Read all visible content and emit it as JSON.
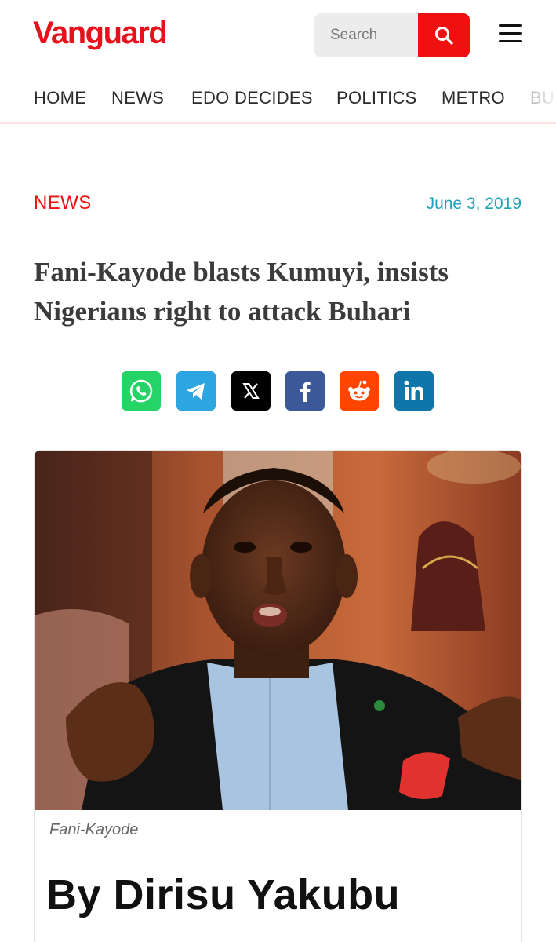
{
  "header": {
    "logo": "Vanguard",
    "search_placeholder": "Search"
  },
  "nav": {
    "items": [
      "HOME",
      "NEWS",
      "EDO DECIDES",
      "POLITICS",
      "METRO",
      "BU"
    ]
  },
  "article": {
    "category": "NEWS",
    "date": "June 3, 2019",
    "title": "Fani-Kayode blasts Kumuyi, insists Nigerians right to attack Buhari",
    "caption": "Fani-Kayode",
    "byline": "By Dirisu Yakubu"
  },
  "share": {
    "icons": [
      "whatsapp-icon",
      "telegram-icon",
      "x-icon",
      "facebook-icon",
      "reddit-icon",
      "linkedin-icon"
    ],
    "colors": {
      "whatsapp": "#25d366",
      "telegram": "#2ca5e0",
      "x": "#000000",
      "facebook": "#3b5998",
      "reddit": "#ff4500",
      "linkedin": "#0e76a8"
    }
  },
  "colors": {
    "brand": "#e8101a",
    "date": "#1ea3b8"
  }
}
